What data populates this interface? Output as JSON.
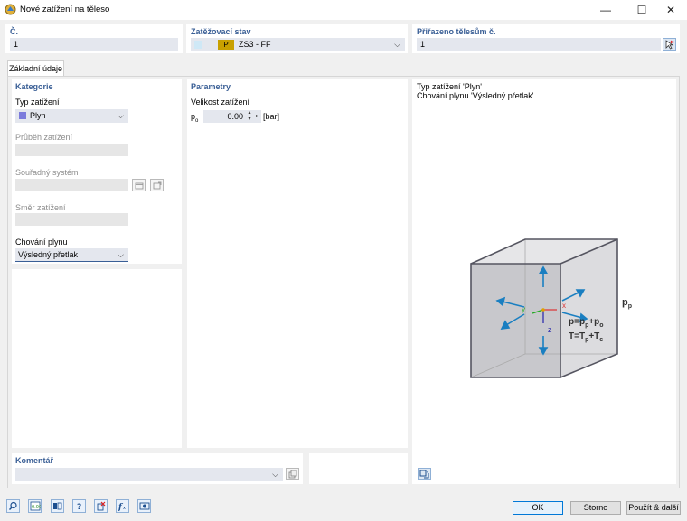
{
  "window": {
    "title": "Nové zatížení na těleso",
    "minimize": "—",
    "maximize": "☐",
    "close": "✕"
  },
  "header": {
    "number_label": "Č.",
    "number_value": "1",
    "load_case_label": "Zatěžovací stav",
    "load_case_badge": "P",
    "load_case_value": "ZS3 - FF",
    "assigned_label": "Přiřazeno tělesům č.",
    "assigned_value": "1"
  },
  "tabs": [
    {
      "label": "Základní údaje"
    }
  ],
  "category": {
    "title": "Kategorie",
    "load_type_label": "Typ zatížení",
    "load_type_value": "Plyn",
    "load_type_color": "#7b7bdc",
    "distribution_label": "Průběh zatížení",
    "coordinate_label": "Souřadný systém",
    "direction_label": "Směr zatížení",
    "gas_behavior_label": "Chování plynu",
    "gas_behavior_value": "Výsledný přetlak"
  },
  "parameters": {
    "title": "Parametry",
    "load_size_label": "Velikost zatížení",
    "symbol": "p",
    "symbol_sub": "o",
    "value": "0.00",
    "unit": "[bar]"
  },
  "preview": {
    "line1": "Typ zatížení 'Plyn'",
    "line2": "Chování plynu 'Výsledný přetlak'",
    "formula1": "p=p",
    "formula1_sub": "p",
    "formula1_rest": "+p",
    "formula1_sub2": "o",
    "formula2": "T=T",
    "formula2_sub": "p",
    "formula2_rest": "+T",
    "formula2_sub2": "c",
    "side_label": "p",
    "side_sub": "p",
    "axis_x": "x",
    "axis_y": "y",
    "axis_z": "z"
  },
  "comment": {
    "label": "Komentář",
    "value": ""
  },
  "buttons": {
    "ok": "OK",
    "cancel": "Storno",
    "apply_next": "Použít & další"
  },
  "toolbar": {
    "icons": [
      "search-icon",
      "units-icon",
      "info-icon",
      "help-icon",
      "delete-icon",
      "function-icon",
      "view-icon"
    ]
  },
  "colors": {
    "accent": "#3a5f96",
    "arrow": "#1a7fc1"
  }
}
